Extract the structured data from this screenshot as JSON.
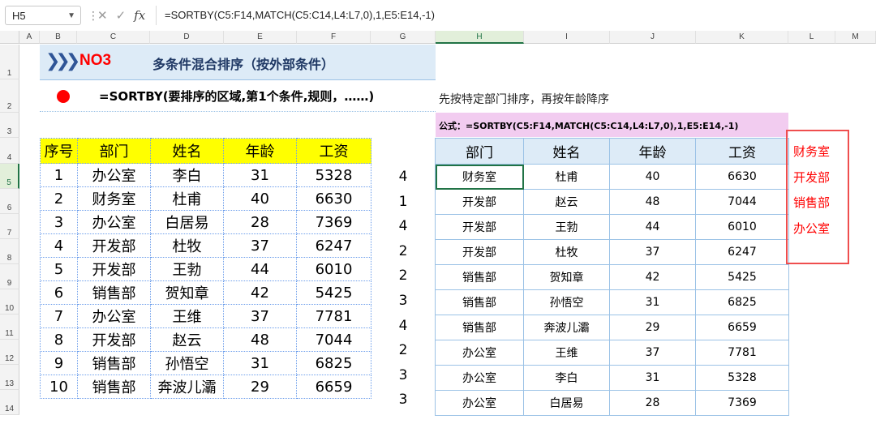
{
  "formula_bar": {
    "name_box": "H5",
    "fx_label": "fx",
    "formula": "=SORTBY(C5:F14,MATCH(C5:C14,L4:L7,0),1,E5:E14,-1)"
  },
  "columns": [
    "A",
    "B",
    "C",
    "D",
    "E",
    "F",
    "G",
    "H",
    "I",
    "J",
    "K",
    "L",
    "M"
  ],
  "rows": [
    "1",
    "2",
    "3",
    "4",
    "5",
    "6",
    "7",
    "8",
    "9",
    "10",
    "11",
    "12",
    "13",
    "14"
  ],
  "title": {
    "tag": "NO3",
    "text": "多条件混合排序（按外部条件）"
  },
  "syntax": "=SORTBY(要排序的区域,第1个条件,规则，……)",
  "note": "先按特定部门排序，再按年龄降序",
  "formula_label": "公式：=SORTBY(C5:F14,MATCH(C5:C14,L4:L7,0),1,E5:E14,-1)",
  "left_table": {
    "headers": [
      "序号",
      "部门",
      "姓名",
      "年龄",
      "工资"
    ],
    "rows": [
      [
        "1",
        "办公室",
        "李白",
        "31",
        "5328"
      ],
      [
        "2",
        "财务室",
        "杜甫",
        "40",
        "6630"
      ],
      [
        "3",
        "办公室",
        "白居易",
        "28",
        "7369"
      ],
      [
        "4",
        "开发部",
        "杜牧",
        "37",
        "6247"
      ],
      [
        "5",
        "开发部",
        "王勃",
        "44",
        "6010"
      ],
      [
        "6",
        "销售部",
        "贺知章",
        "42",
        "5425"
      ],
      [
        "7",
        "办公室",
        "王维",
        "37",
        "7781"
      ],
      [
        "8",
        "开发部",
        "赵云",
        "48",
        "7044"
      ],
      [
        "9",
        "销售部",
        "孙悟空",
        "31",
        "6825"
      ],
      [
        "10",
        "销售部",
        "奔波儿灞",
        "29",
        "6659"
      ]
    ]
  },
  "g_column": [
    "4",
    "1",
    "4",
    "2",
    "2",
    "3",
    "4",
    "2",
    "3",
    "3"
  ],
  "right_table": {
    "headers": [
      "部门",
      "姓名",
      "年龄",
      "工资"
    ],
    "rows": [
      [
        "财务室",
        "杜甫",
        "40",
        "6630"
      ],
      [
        "开发部",
        "赵云",
        "48",
        "7044"
      ],
      [
        "开发部",
        "王勃",
        "44",
        "6010"
      ],
      [
        "开发部",
        "杜牧",
        "37",
        "6247"
      ],
      [
        "销售部",
        "贺知章",
        "42",
        "5425"
      ],
      [
        "销售部",
        "孙悟空",
        "31",
        "6825"
      ],
      [
        "销售部",
        "奔波儿灞",
        "29",
        "6659"
      ],
      [
        "办公室",
        "王维",
        "37",
        "7781"
      ],
      [
        "办公室",
        "李白",
        "31",
        "5328"
      ],
      [
        "办公室",
        "白居易",
        "28",
        "7369"
      ]
    ]
  },
  "dept_order": [
    "财务室",
    "开发部",
    "销售部",
    "办公室"
  ],
  "colors": {
    "title_band": "#ddebf7",
    "header_yellow": "#ffff00",
    "formula_box": "#f2ccf0",
    "accent_red": "#ff0000",
    "excel_green": "#217346"
  }
}
